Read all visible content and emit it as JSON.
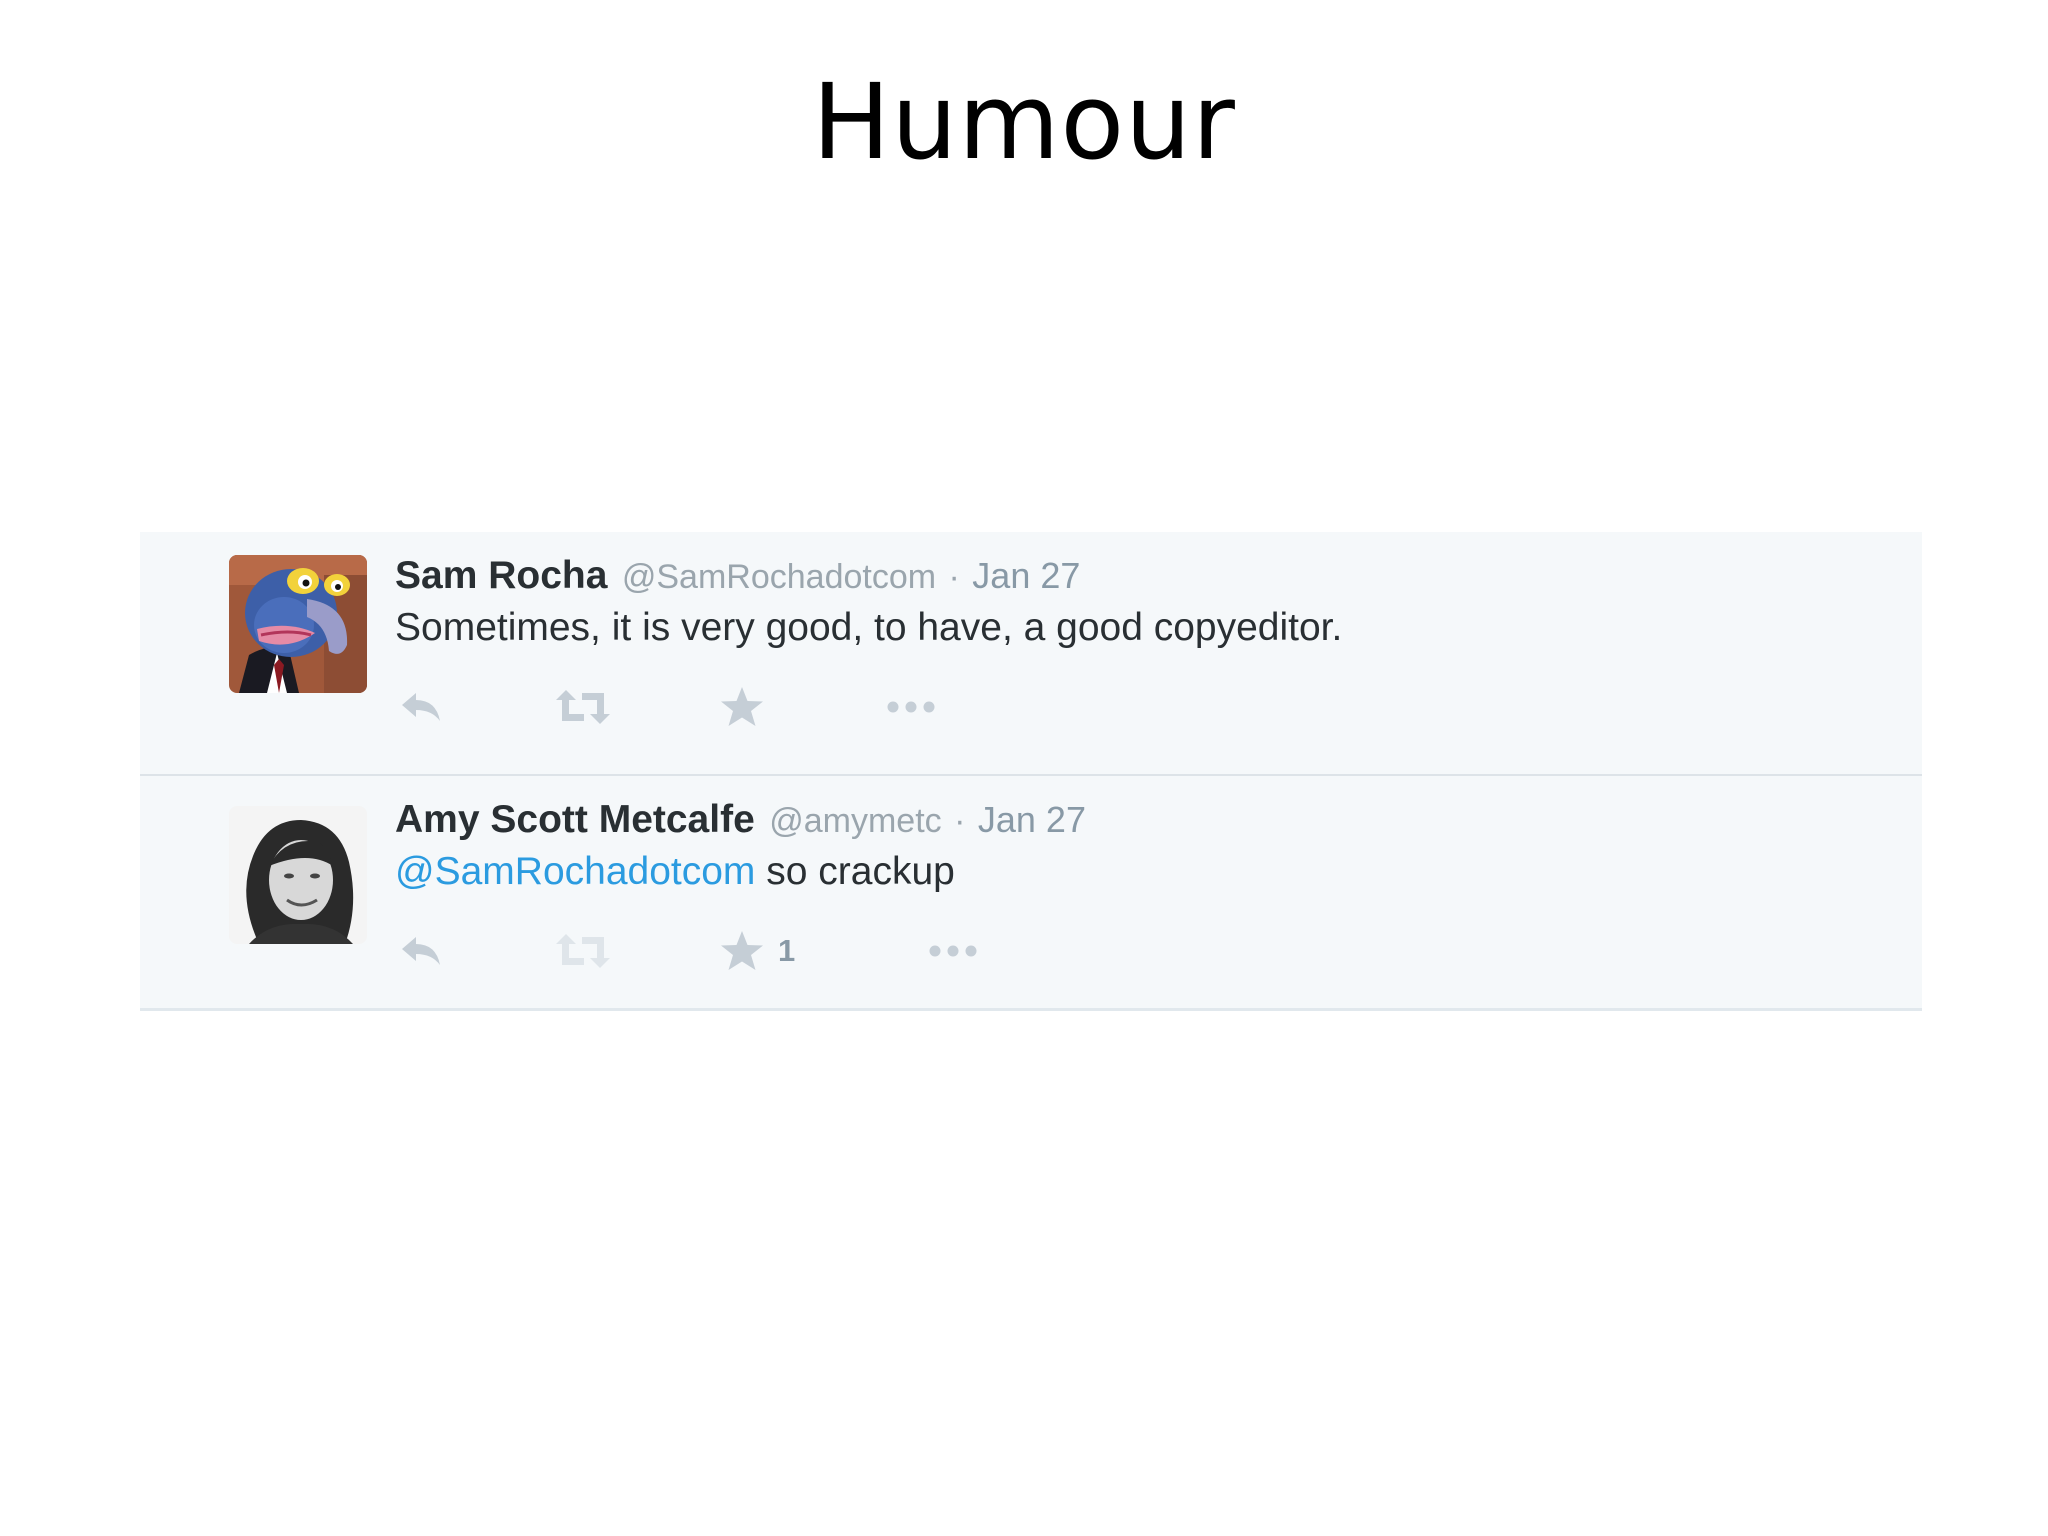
{
  "slide": {
    "title": "Humour"
  },
  "tweets": [
    {
      "name": "Sam Rocha",
      "handle": "@SamRochadotcom",
      "separator": "·",
      "date": "Jan 27",
      "text": "Sometimes, it is very good, to have, a good copyeditor.",
      "avatar_icon": "muppet-avatar",
      "actions": [
        "reply-icon",
        "retweet-icon",
        "favorite-icon",
        "more-icon"
      ]
    },
    {
      "name": "Amy Scott Metcalfe",
      "handle": "@amymetc",
      "separator": "·",
      "date": "Jan 27",
      "mention": "@SamRochadotcom",
      "text": " so crackup",
      "favorite_count": "1",
      "avatar_icon": "portrait-avatar",
      "actions": [
        "reply-icon",
        "retweet-icon",
        "favorite-icon",
        "more-icon"
      ]
    }
  ],
  "colors": {
    "timeline_bg": "#f5f8fa",
    "name": "#292f33",
    "muted": "#8899a6",
    "mention": "#2b9be0",
    "icon": "#c5ced6"
  }
}
